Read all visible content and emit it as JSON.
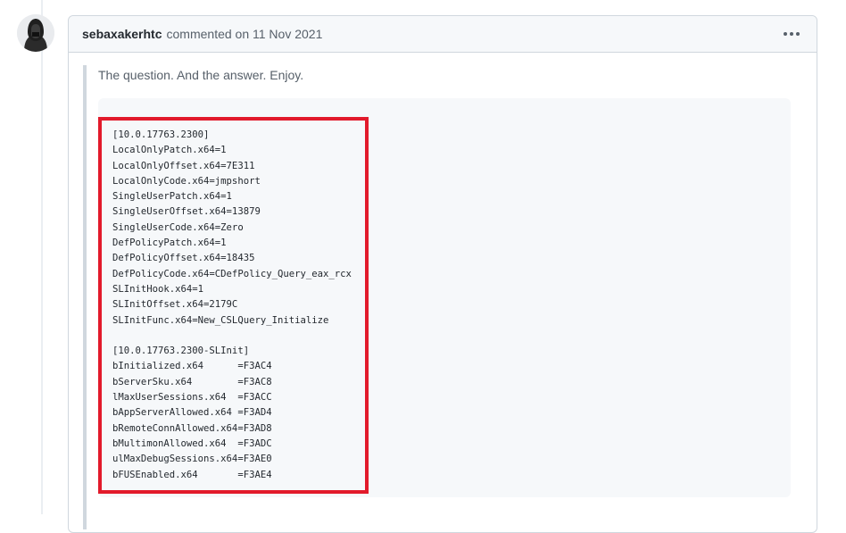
{
  "comment": {
    "author": "sebaxakerhtc",
    "meta": "commented on 11 Nov 2021",
    "menu_icon": "kebab-horizontal-icon",
    "quote": "The question. And the answer. Enjoy.",
    "code_lines": [
      "[10.0.17763.2300]",
      "LocalOnlyPatch.x64=1",
      "LocalOnlyOffset.x64=7E311",
      "LocalOnlyCode.x64=jmpshort",
      "SingleUserPatch.x64=1",
      "SingleUserOffset.x64=13879",
      "SingleUserCode.x64=Zero",
      "DefPolicyPatch.x64=1",
      "DefPolicyOffset.x64=18435",
      "DefPolicyCode.x64=CDefPolicy_Query_eax_rcx",
      "SLInitHook.x64=1",
      "SLInitOffset.x64=2179C",
      "SLInitFunc.x64=New_CSLQuery_Initialize",
      "",
      "[10.0.17763.2300-SLInit]",
      "bInitialized.x64      =F3AC4",
      "bServerSku.x64        =F3AC8",
      "lMaxUserSessions.x64  =F3ACC",
      "bAppServerAllowed.x64 =F3AD4",
      "bRemoteConnAllowed.x64=F3AD8",
      "bMultimonAllowed.x64  =F3ADC",
      "ulMaxDebugSessions.x64=F3AE0",
      "bFUSEnabled.x64       =F3AE4"
    ]
  },
  "colors": {
    "highlight_border": "#e21a2b",
    "code_background": "#f6f8fa",
    "header_background": "#f6f8fa",
    "border": "#d0d7de"
  }
}
